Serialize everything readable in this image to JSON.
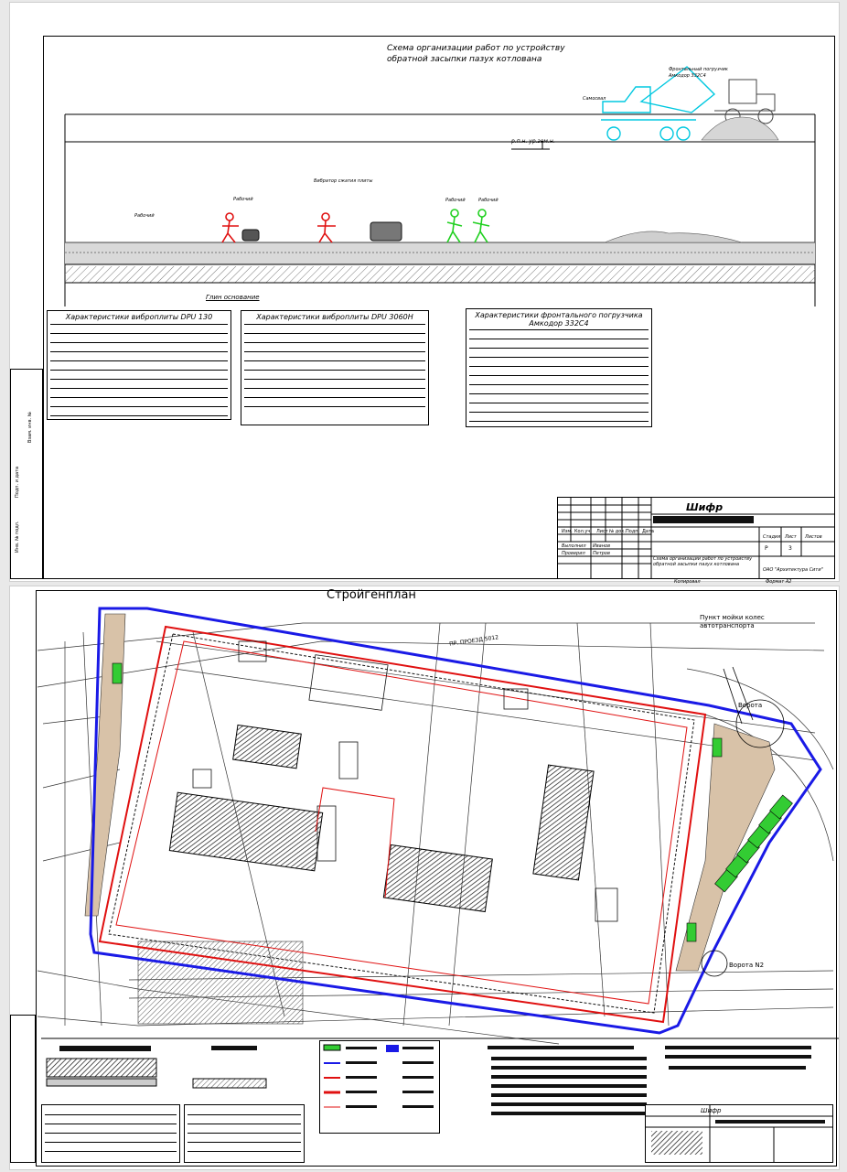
{
  "sheet1": {
    "title": "Схема организации работ по устройству обратной засыпки пазух котлована",
    "level_mark": "р.п.н. ур.зем.н.",
    "base_label": "Глин основание",
    "vehicle_labels": {
      "dump_truck": "Самосвал",
      "loader": "Фронтальный погрузчик Амкодор 332С4"
    },
    "worker_labels": [
      "Вибратор сжатия плиты",
      "Рабочий",
      "Рабочий",
      "Рабочий",
      "Рабочий"
    ],
    "tables": [
      {
        "title": "Характеристики виброплиты DPU 130"
      },
      {
        "title": "Характеристики виброплиты DPU 3060H"
      },
      {
        "title": "Характеристики фронтального погрузчика Амкодор 332С4"
      }
    ],
    "title_block": {
      "cipher": "Шифр",
      "row_labels": [
        "Изм.",
        "Кол.уч.",
        "Лист",
        "№ док.",
        "Подп.",
        "Дата"
      ],
      "people": [
        {
          "role": "Выполнил",
          "name": "Иванов"
        },
        {
          "role": "Проверил",
          "name": "Петров"
        }
      ],
      "drawing_name": "Схема организации работ по устройству обратной засыпки пазух котлована",
      "stage_head": [
        "Стадия",
        "Лист",
        "Листов"
      ],
      "stage_values": [
        "Р",
        "3",
        ""
      ],
      "org": "ОАО \"Архитектура Сити\"",
      "footer": {
        "copied": "Копировал",
        "format": "Формат А2"
      }
    },
    "side_stamp_labels": [
      "Взам. инв. №",
      "Подп. и дата",
      "Инв. № подл."
    ]
  },
  "sheet2": {
    "title": "Стройгенплан",
    "labels": {
      "wheel_wash": "Пункт мойки колес автотранспорта",
      "gate1": "Ворота",
      "gate2": "Ворота N2",
      "street": "ПР. ПРОЕЗД 5012"
    },
    "title_block": {
      "cipher": "Шифр"
    }
  },
  "colors": {
    "fence_blue": "#1a1ae6",
    "fence_red": "#e01010",
    "cyan_equipment": "#00c8e0",
    "workers_red": "#e01010",
    "workers_green": "#20d020",
    "buildings_green": "#33cc33",
    "pad_tan": "#d8c2a8"
  },
  "icons": [
    "dump-truck-icon",
    "loader-icon",
    "worker-icon",
    "compactor-icon",
    "crane-icon"
  ]
}
